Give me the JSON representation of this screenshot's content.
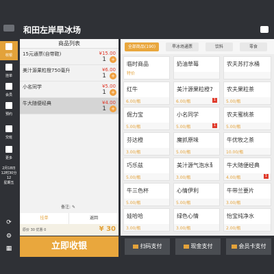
{
  "header": {
    "shop_name": "和田左岸旱冰场"
  },
  "sidebar": {
    "items": [
      {
        "label": "收银",
        "icon": "cashier-icon",
        "active": true
      },
      {
        "label": "挂单",
        "icon": "hold-order-icon",
        "active": false
      },
      {
        "label": "会员",
        "icon": "member-icon",
        "active": false
      },
      {
        "label": "预约",
        "icon": "reservation-icon",
        "active": false
      },
      {
        "label": "交班",
        "icon": "shift-icon",
        "active": false
      },
      {
        "label": "更多",
        "icon": "more-icon",
        "active": false
      }
    ],
    "clock_lines": [
      "2月18日",
      "12时30分12",
      "星期五"
    ]
  },
  "order": {
    "title": "商品列表",
    "items": [
      {
        "name": "15元通票(自带鞋)",
        "price": "¥15.00",
        "qty": "1"
      },
      {
        "name": "美汁源果粒橙750毫升",
        "price": "¥6.00",
        "qty": "1"
      },
      {
        "name": "小名同学",
        "price": "¥5.00",
        "qty": "1"
      },
      {
        "name": "牛大随便经典",
        "price": "¥4.00",
        "qty": "1"
      }
    ],
    "remark_label": "备注:",
    "tab_left": "挂单",
    "tab_right": "返回",
    "totals_info": "原价 30  优惠 0",
    "amount": "¥ 30"
  },
  "checkout_label": "立即收银",
  "categories": [
    {
      "label": "全部商品(190)",
      "active": true
    },
    {
      "label": "旱冰场通票",
      "active": false
    },
    {
      "label": "饮料",
      "active": false
    },
    {
      "label": "零食",
      "active": false
    }
  ],
  "products": [
    {
      "name": "临时商品",
      "price": "",
      "sub": "特价",
      "badge": ""
    },
    {
      "name": "奶油草莓",
      "price": "",
      "sub": "",
      "badge": ""
    },
    {
      "name": "农夫苏打水桶",
      "price": "",
      "sub": "",
      "badge": ""
    },
    {
      "name": "红牛",
      "price": "6.00/瓶",
      "sub": "",
      "badge": ""
    },
    {
      "name": "美汁源果粒橙750毫升",
      "price": "6.00/瓶",
      "sub": "",
      "badge": "1"
    },
    {
      "name": "农夫果粒茶",
      "price": "5.00/瓶",
      "sub": "",
      "badge": ""
    },
    {
      "name": "倔力宝",
      "price": "5.00/瓶",
      "sub": "",
      "badge": ""
    },
    {
      "name": "小名同学",
      "price": "5.00/瓶",
      "sub": "",
      "badge": "1"
    },
    {
      "name": "农夫蜜桃茶",
      "price": "5.00/瓶",
      "sub": "",
      "badge": ""
    },
    {
      "name": "芬达橙",
      "price": "3.00/瓶",
      "sub": "",
      "badge": ""
    },
    {
      "name": "魔抓原味",
      "price": "5.00/瓶",
      "sub": "",
      "badge": ""
    },
    {
      "name": "牛优牧之茶",
      "price": "10.00/瓶",
      "sub": "",
      "badge": ""
    },
    {
      "name": "巧乐兹",
      "price": "5.00/瓶",
      "sub": "",
      "badge": ""
    },
    {
      "name": "美汁源气泡水葡萄味",
      "price": "3.00/瓶",
      "sub": "",
      "badge": ""
    },
    {
      "name": "牛大随便经典",
      "price": "4.00/瓶",
      "sub": "",
      "badge": "1"
    },
    {
      "name": "牛三色杯",
      "price": "5.00/瓶",
      "sub": "",
      "badge": ""
    },
    {
      "name": "心情伊利",
      "price": "5.00/瓶",
      "sub": "",
      "badge": ""
    },
    {
      "name": "牛带兰要片",
      "price": "3.00/瓶",
      "sub": "",
      "badge": ""
    },
    {
      "name": "娃哈哈",
      "price": "3.00/瓶",
      "sub": "",
      "badge": ""
    },
    {
      "name": "绿色心情",
      "price": "3.00/瓶",
      "sub": "",
      "badge": ""
    },
    {
      "name": "怡宝纯净水",
      "price": "2.00/瓶",
      "sub": "",
      "badge": ""
    }
  ],
  "pay": [
    {
      "label": "扫码支付",
      "icon": "qr-scan-icon"
    },
    {
      "label": "现金支付",
      "icon": "cash-icon"
    },
    {
      "label": "会员卡支付",
      "icon": "card-icon"
    }
  ],
  "colors": {
    "accent": "#e9a73d",
    "dark": "#2f3136",
    "price": "#e03b2c"
  }
}
